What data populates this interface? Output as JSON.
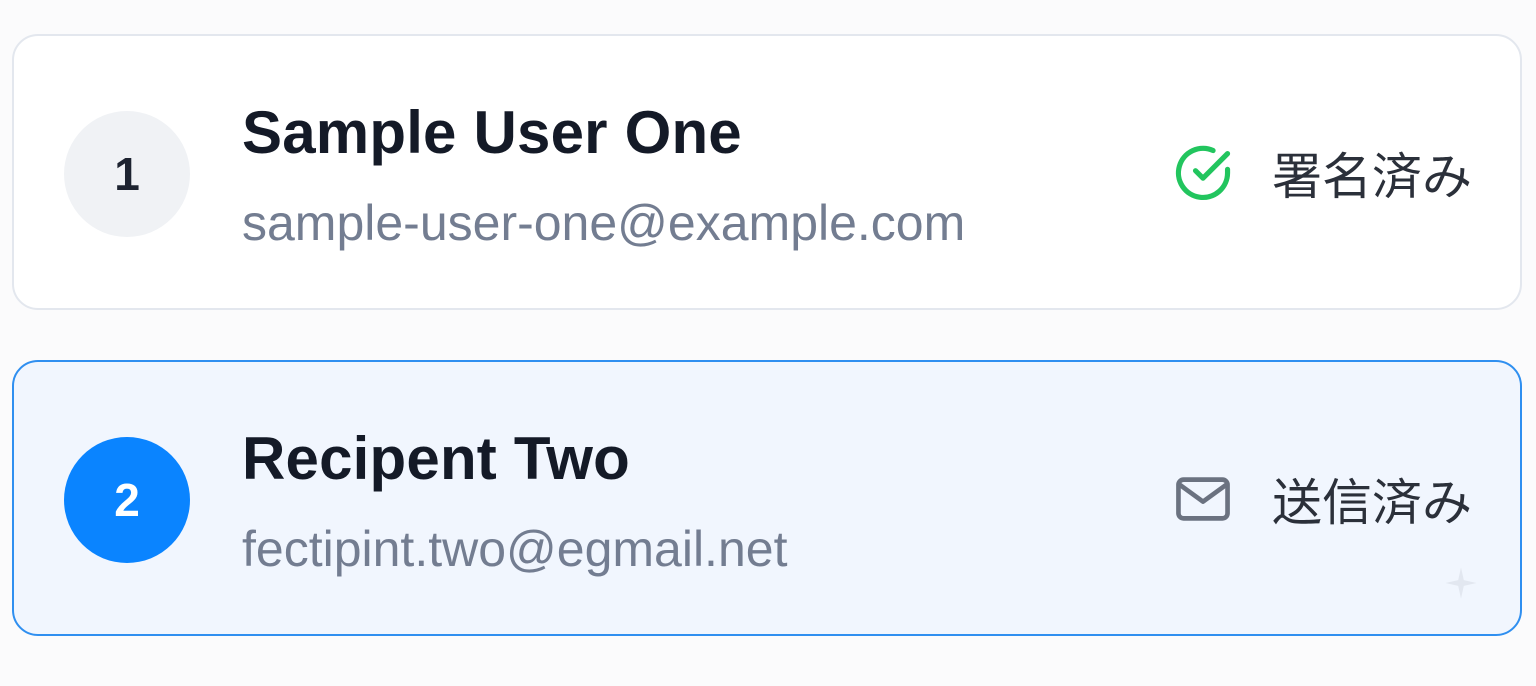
{
  "signers": [
    {
      "step": "1",
      "name": "Sample User One",
      "email": "sample-user-one@example.com",
      "status_label": "署名済み",
      "status_icon": "check-circle-icon",
      "selected": false
    },
    {
      "step": "2",
      "name": "Recipent Two",
      "email": "fectipint.two@egmail.net",
      "status_label": "送信済み",
      "status_icon": "mail-icon",
      "selected": true
    }
  ],
  "colors": {
    "accent": "#0a84ff",
    "selected_border": "#2f8ff0",
    "selected_bg": "#f1f6fe",
    "signed_green": "#22c55e",
    "muted_text": "#737d91"
  }
}
